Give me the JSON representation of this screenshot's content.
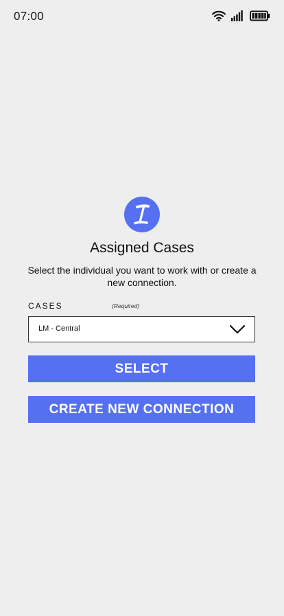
{
  "status_bar": {
    "time": "07:00",
    "icons": [
      "wifi-icon",
      "signal-icon",
      "battery-icon"
    ]
  },
  "logo": {
    "icon": "case-logo-icon",
    "color": "#5670f2"
  },
  "title": "Assigned Cases",
  "subtitle": "Select the individual you want to work with or create a new connection.",
  "cases_field": {
    "label": "CASES",
    "required_note": "(Required)",
    "selected_value": "LM - Central"
  },
  "buttons": {
    "select_label": "SELECT",
    "create_label": "CREATE NEW CONNECTION"
  },
  "colors": {
    "accent": "#5670f2",
    "background": "#eeeeee"
  }
}
